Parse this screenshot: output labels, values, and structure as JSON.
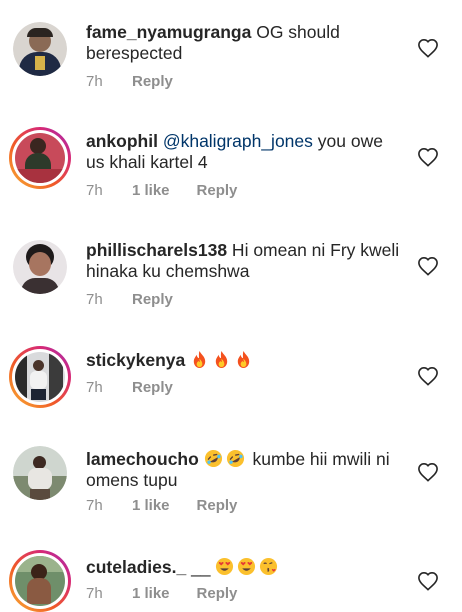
{
  "comments": [
    {
      "username": "fame_nyamugranga",
      "mention": "",
      "text": " OG should berespected",
      "time": "7h",
      "likes": "",
      "reply": "Reply",
      "emojis": []
    },
    {
      "username": "ankophil",
      "mention": " @khaligraph_jones",
      "text": " you owe us khali kartel 4",
      "time": "7h",
      "likes": "1 like",
      "reply": "Reply",
      "emojis": []
    },
    {
      "username": "phillischarels138",
      "mention": "",
      "text": " Hi omean ni Fry kweli hinaka ku chemshwa",
      "time": "7h",
      "likes": "",
      "reply": "Reply",
      "emojis": []
    },
    {
      "username": "stickykenya",
      "mention": "",
      "text": " ",
      "time": "7h",
      "likes": "",
      "reply": "Reply",
      "emojis": [
        "fire-emoji",
        "fire-emoji",
        "fire-emoji"
      ]
    },
    {
      "username": "lamechoucho",
      "mention": "",
      "text": " kumbe hii mwili ni omens tupu",
      "time": "7h",
      "likes": "1 like",
      "reply": "Reply",
      "emojis": [
        "rolling-laughing-emoji",
        "rolling-laughing-emoji"
      ]
    },
    {
      "username": "cuteladies._",
      "mention": "",
      "text": " __",
      "time": "7h",
      "likes": "1 like",
      "reply": "Reply",
      "emojis": [
        "heart-eyes-emoji",
        "heart-eyes-emoji",
        "kissing-heart-emoji"
      ]
    }
  ],
  "icons": {
    "like": "heart-outline-icon"
  },
  "colors": {
    "text": "#262626",
    "muted": "#8e8e8e",
    "mention": "#003569",
    "story_ring": "#d62976"
  }
}
